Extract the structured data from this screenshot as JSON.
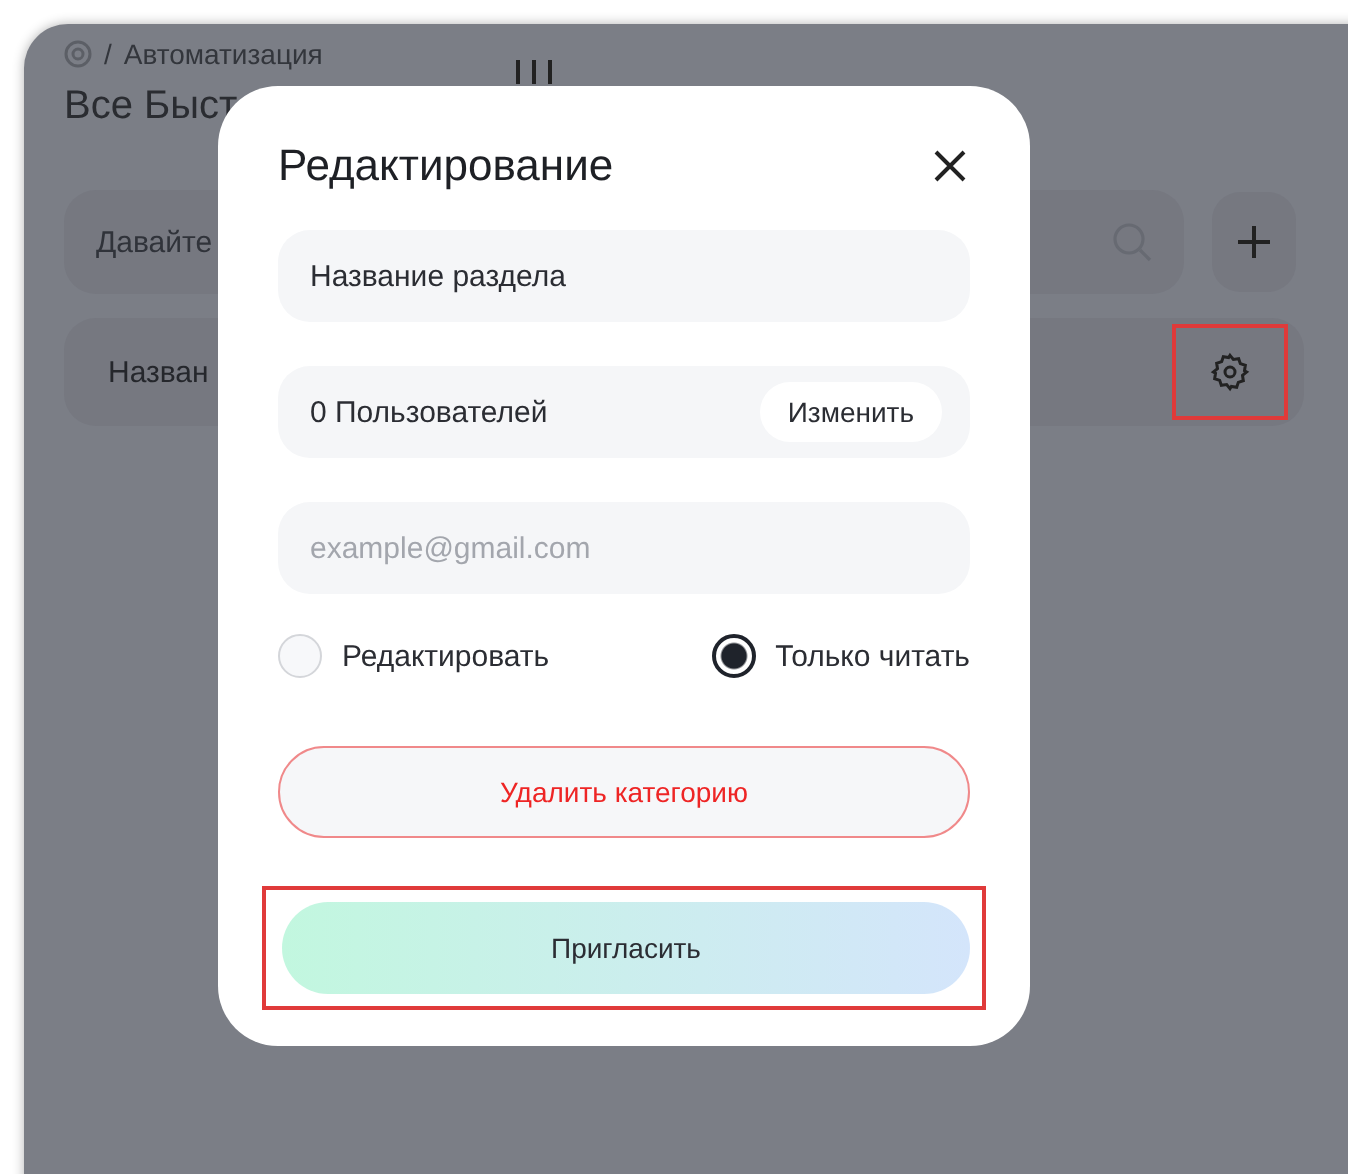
{
  "background": {
    "breadcrumb": {
      "separator": "/",
      "section": "Автоматизация"
    },
    "title": "Все Быст",
    "search": {
      "placeholder": "Давайте"
    },
    "row": {
      "label": "Назван",
      "settings_highlighted": true
    }
  },
  "modal": {
    "title": "Редактирование",
    "name_field": {
      "value": "Название раздела"
    },
    "users": {
      "count": "0 Пользователей",
      "button": "Изменить"
    },
    "email_field": {
      "placeholder": "example@gmail.com"
    },
    "access": [
      {
        "label": "Редактировать",
        "selected": false
      },
      {
        "label": "Только читать",
        "selected": true
      }
    ],
    "delete_button": "Удалить категорию",
    "invite_button": {
      "label": "Пригласить",
      "highlighted": true
    }
  }
}
